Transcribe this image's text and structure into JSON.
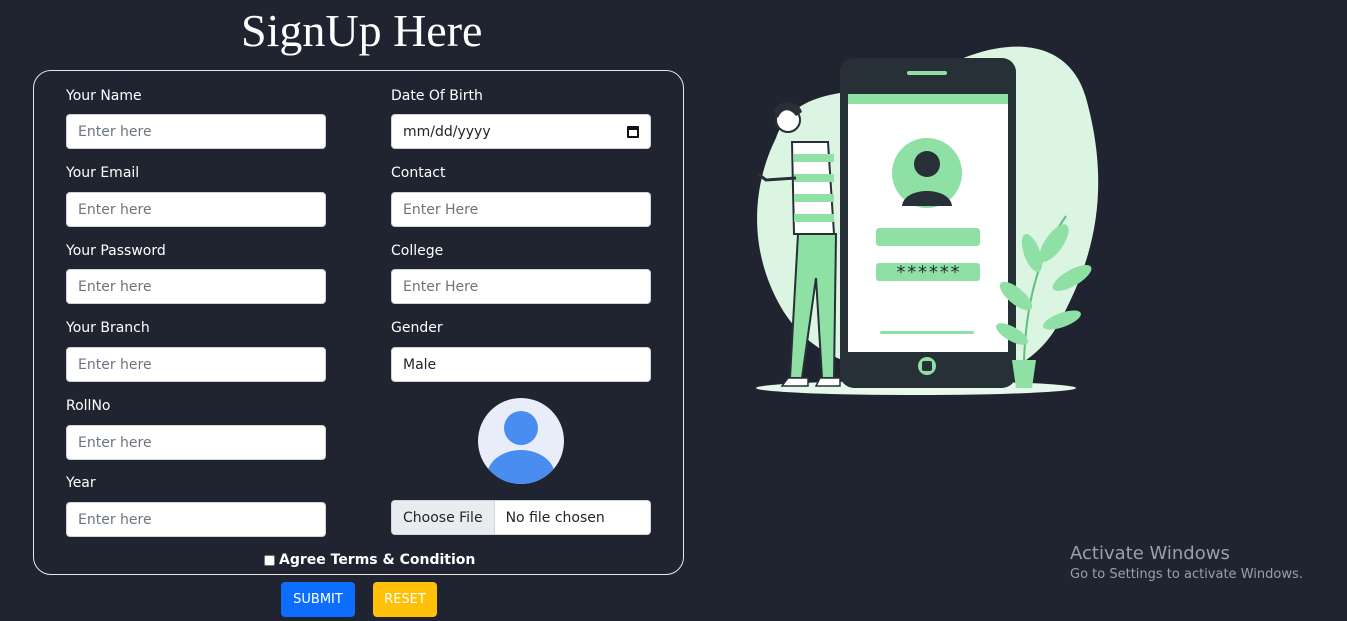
{
  "page": {
    "title": "SignUp Here"
  },
  "form": {
    "name": {
      "label": "Your Name",
      "placeholder": "Enter here"
    },
    "dob": {
      "label": "Date Of Birth",
      "value": "mm/dd/yyyy"
    },
    "email": {
      "label": "Your Email",
      "placeholder": "Enter here"
    },
    "contact": {
      "label": "Contact",
      "placeholder": "Enter Here"
    },
    "password": {
      "label": "Your Password",
      "placeholder": "Enter here"
    },
    "college": {
      "label": "College",
      "placeholder": "Enter Here"
    },
    "branch": {
      "label": "Your Branch",
      "placeholder": "Enter here"
    },
    "gender": {
      "label": "Gender",
      "value": "Male"
    },
    "rollno": {
      "label": "RollNo",
      "placeholder": "Enter here"
    },
    "year": {
      "label": "Year",
      "placeholder": "Enter here"
    },
    "file": {
      "button": "Choose File",
      "status": "No file chosen"
    },
    "agree_label": "Agree Terms & Condition",
    "submit_label": "SUBMIT",
    "reset_label": "RESET"
  },
  "illustration": {
    "password_mask": "******"
  },
  "watermark": {
    "title": "Activate Windows",
    "subtitle": "Go to Settings to activate Windows."
  },
  "colors": {
    "background": "#1f2430",
    "submit": "#0d6efd",
    "reset": "#ffc107",
    "accent_green": "#8ee0a4"
  }
}
